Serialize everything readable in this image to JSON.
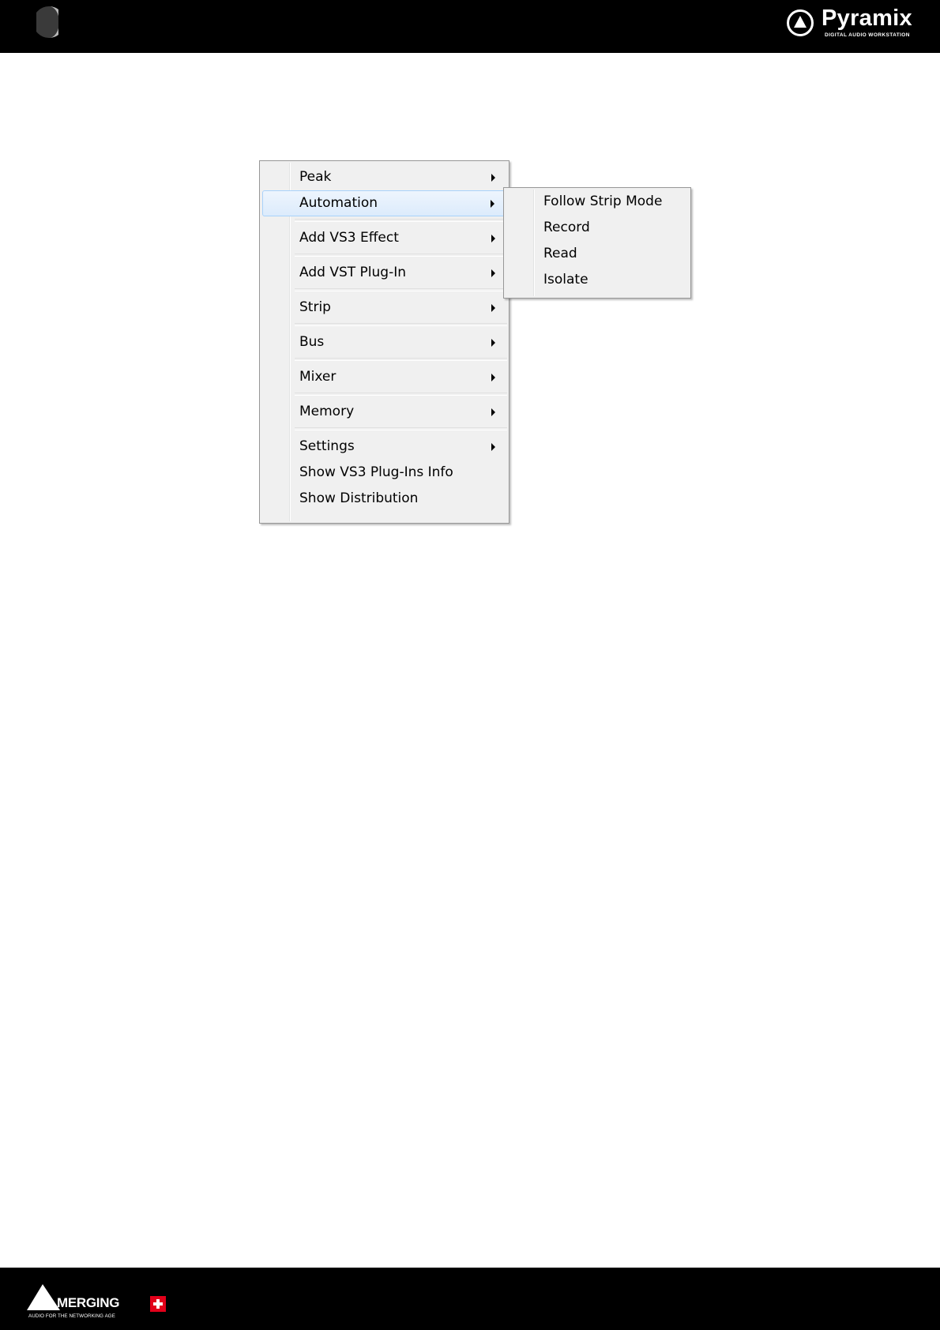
{
  "header": {
    "brand_name": "Pyramix",
    "brand_tagline": "DIGITAL AUDIO WORKSTATION",
    "moon_icon": "moon-icon",
    "logo_icon": "pyramix-logo-icon"
  },
  "context_menu": {
    "items": [
      {
        "label": "Peak",
        "has_submenu": true
      },
      {
        "label": "Automation",
        "has_submenu": true,
        "highlighted": true
      },
      {
        "label": "Add VS3 Effect",
        "has_submenu": true
      },
      {
        "label": "Add VST Plug-In",
        "has_submenu": true
      },
      {
        "label": "Strip",
        "has_submenu": true
      },
      {
        "label": "Bus",
        "has_submenu": true
      },
      {
        "label": "Mixer",
        "has_submenu": true
      },
      {
        "label": "Memory",
        "has_submenu": true
      },
      {
        "label": "Settings",
        "has_submenu": true
      },
      {
        "label": "Show VS3 Plug-Ins Info",
        "has_submenu": false
      },
      {
        "label": "Show Distribution",
        "has_submenu": false
      }
    ]
  },
  "submenu_automation": {
    "items": [
      {
        "label": "Follow Strip Mode"
      },
      {
        "label": "Record"
      },
      {
        "label": "Read"
      },
      {
        "label": "Isolate"
      }
    ]
  },
  "footer": {
    "company_name": "MERGING",
    "company_tagline": "AUDIO FOR THE NETWORKING AGE",
    "logo_icon": "merging-logo-icon",
    "flag_icon": "swiss-cross-icon"
  },
  "colors": {
    "bar_background": "#000000",
    "menu_background": "#f0f0f0",
    "highlight_border": "#a8d2fb",
    "swiss_red": "#e2001a"
  }
}
